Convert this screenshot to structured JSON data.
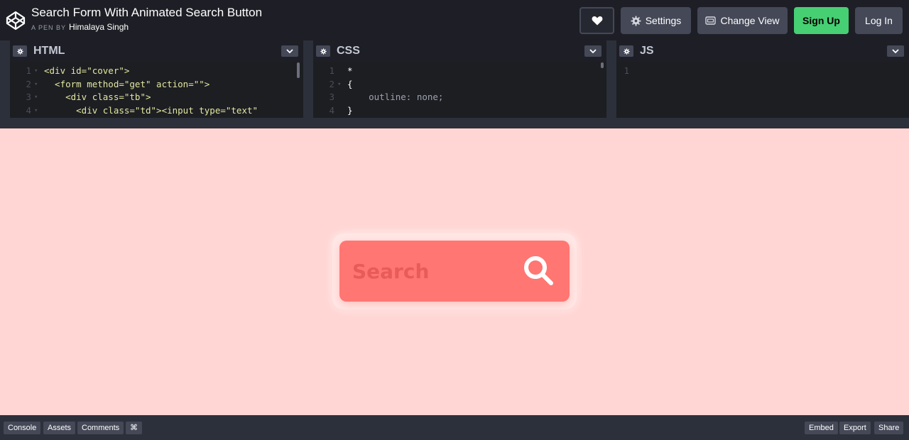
{
  "header": {
    "title": "Search Form With Animated Search Button",
    "by_label": "A PEN BY",
    "author": "Himalaya Singh",
    "settings_label": "Settings",
    "change_view_label": "Change View",
    "sign_up_label": "Sign Up",
    "log_in_label": "Log In",
    "icons": [
      "codepen-logo-icon",
      "heart-icon",
      "gear-icon",
      "change-view-icon"
    ]
  },
  "editors": [
    {
      "name": "HTML",
      "line_numbers": [
        "1",
        "2",
        "3",
        "4"
      ],
      "lines": [
        "<div id=\"cover\">",
        "  <form method=\"get\" action=\"\">",
        "    <div class=\"tb\">",
        "      <div class=\"td\"><input type=\"text\""
      ]
    },
    {
      "name": "CSS",
      "line_numbers": [
        "1",
        "2",
        "3",
        "4"
      ],
      "lines": [
        "*",
        "{",
        "    outline: none;",
        "}"
      ]
    },
    {
      "name": "JS",
      "line_numbers": [
        "1"
      ],
      "lines": [
        ""
      ]
    }
  ],
  "preview": {
    "search_placeholder": "Search",
    "search_value": "",
    "colors": {
      "background": "#ffd6d4",
      "search_box": "#ff7672",
      "icon": "#ffffff"
    }
  },
  "footer": {
    "left": [
      "Console",
      "Assets",
      "Comments",
      "⌘"
    ],
    "right": [
      "Embed",
      "Export",
      "Share"
    ]
  },
  "colors": {
    "accent": "#47cf73",
    "button": "#444857",
    "chrome": "#1e1f26"
  }
}
